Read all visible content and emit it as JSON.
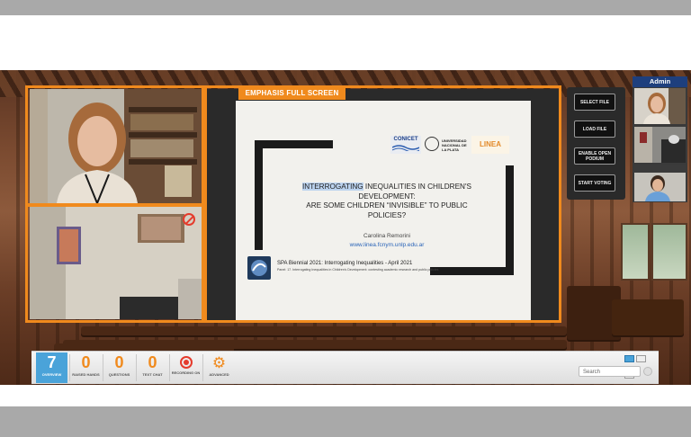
{
  "conference": {
    "emphasis_label": "EMPHASIS FULL SCREEN",
    "controls": [
      {
        "id": "select-file",
        "label": "SELECT FILE"
      },
      {
        "id": "load-file",
        "label": "LOAD FILE"
      },
      {
        "id": "enable-open-podium",
        "label": "ENABLE OPEN PODIUM"
      },
      {
        "id": "start-voting",
        "label": "START VOTING"
      }
    ],
    "admin_label": "Admin"
  },
  "slide": {
    "logos": [
      "CONICET",
      "UNIVERSIDAD NACIONAL DE LA PLATA",
      "LINEA"
    ],
    "title_highlight": "INTERROGATING",
    "title_rest_line1": " INEQUALITIES IN CHILDREN'S",
    "title_line2": "DEVELOPMENT:",
    "title_line3": "ARE SOME CHILDREN “INVISIBLE” TO PUBLIC",
    "title_line4": "POLICIES?",
    "author": "Carolina Remorini",
    "url": "www.linea.fcnym.unlp.edu.ar",
    "footer_title": "SPA Biennial 2021: Interrogating Inequalities - April 2021",
    "footer_sub": "Panel: 17. Interrogating Inequalities in Children's Development: contesting academic research and public policies"
  },
  "toolbar": {
    "items": [
      {
        "value": "7",
        "label": "OVERVIEW",
        "active": true
      },
      {
        "value": "0",
        "label": "RAISED HANDS"
      },
      {
        "value": "0",
        "label": "QUESTIONS"
      },
      {
        "value": "0",
        "label": "TEXT CHAT"
      },
      {
        "icon": "record-icon",
        "label": "RECORDING ON"
      },
      {
        "icon": "gear-icon",
        "label": "ADVANCED"
      }
    ],
    "search_placeholder": "Search"
  },
  "colors": {
    "accent": "#f08a1d",
    "admin": "#1e3f7d",
    "overview_active": "#4aa3d9"
  }
}
